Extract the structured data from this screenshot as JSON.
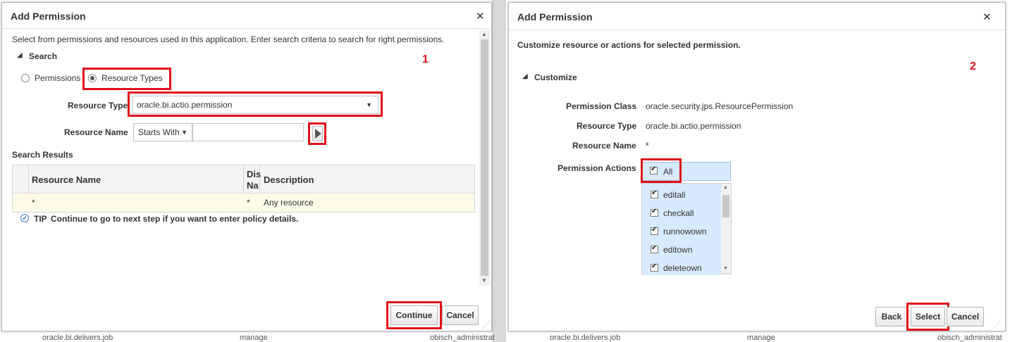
{
  "colors": {
    "highlight": "#e0111b",
    "selection": "#d7eaff",
    "row_bg": "#fbfbe8"
  },
  "dialog1": {
    "title": "Add Permission",
    "close_glyph": "✕",
    "instructions": "Select from permissions and resources used in this application. Enter search criteria to search for right permissions.",
    "search_section": "Search",
    "step": "1",
    "radio_permissions": "Permissions",
    "radio_resource_types": "Resource Types",
    "resource_type_label": "Resource Type",
    "resource_type_value": "oracle.bi.actio.permission",
    "resource_name_label": "Resource Name",
    "operator_value": "Starts With",
    "search_results_label": "Search Results",
    "table": {
      "col_resource_name": "Resource Name",
      "col_display_name_line1": "Dis",
      "col_display_name_line2": "Na",
      "col_description": "Description",
      "rows": [
        {
          "resource_name": "*",
          "display_name": "*",
          "description": "Any resource"
        }
      ]
    },
    "tip_label": "TIP",
    "tip_text": "Continue to go to next step if you want to enter policy details.",
    "continue_label": "Continue",
    "cancel_label": "Cancel"
  },
  "dialog2": {
    "title": "Add Permission",
    "close_glyph": "✕",
    "instructions": "Customize resource or actions for selected permission.",
    "customize_section": "Customize",
    "step": "2",
    "permission_class_label": "Permission Class",
    "permission_class_value": "oracle.security.jps.ResourcePermission",
    "resource_type_label": "Resource Type",
    "resource_type_value": "oracle.bi.actio.permission",
    "resource_name_label": "Resource Name",
    "resource_name_value": "*",
    "permission_actions_label": "Permission Actions",
    "all_label": "All",
    "actions": [
      "editall",
      "checkall",
      "runnowown",
      "editown",
      "deleteown"
    ],
    "back_label": "Back",
    "select_label": "Select",
    "cancel_label": "Cancel"
  },
  "background": {
    "bottom_left_a": "oracle.bi.delivers.job",
    "bottom_left_b": "manage",
    "bottom_left_c": "obisch_administrat",
    "bottom_right_a": "oracle.bi.delivers.job",
    "bottom_right_b": "manage",
    "bottom_right_c": "obisch_administrat"
  }
}
